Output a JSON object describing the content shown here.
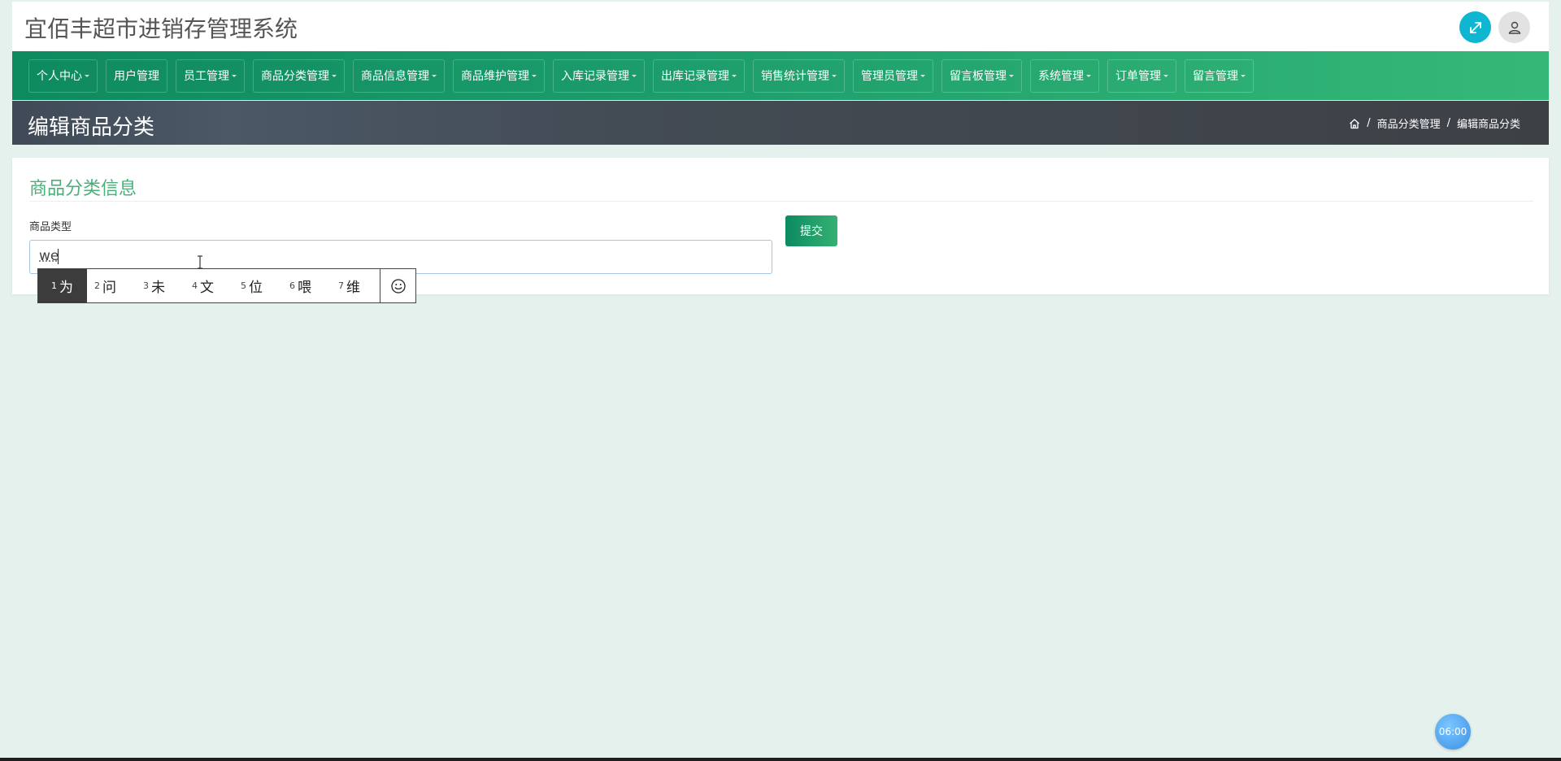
{
  "app": {
    "title": "宜佰丰超市进销存管理系统"
  },
  "header": {
    "expand_icon": "expand-arrows-icon",
    "user_icon": "user-icon",
    "accent_color": "#0fb6d2"
  },
  "nav": {
    "items": [
      {
        "label": "个人中心",
        "dropdown": true
      },
      {
        "label": "用户管理",
        "dropdown": false
      },
      {
        "label": "员工管理",
        "dropdown": true
      },
      {
        "label": "商品分类管理",
        "dropdown": true
      },
      {
        "label": "商品信息管理",
        "dropdown": true
      },
      {
        "label": "商品维护管理",
        "dropdown": true
      },
      {
        "label": "入库记录管理",
        "dropdown": true
      },
      {
        "label": "出库记录管理",
        "dropdown": true
      },
      {
        "label": "销售统计管理",
        "dropdown": true
      },
      {
        "label": "管理员管理",
        "dropdown": true
      },
      {
        "label": "留言板管理",
        "dropdown": true
      },
      {
        "label": "系统管理",
        "dropdown": true
      },
      {
        "label": "订单管理",
        "dropdown": true
      },
      {
        "label": "留言管理",
        "dropdown": true
      }
    ]
  },
  "page_header": {
    "title": "编辑商品分类",
    "breadcrumb": {
      "home_icon": "home-icon",
      "items": [
        "商品分类管理",
        "编辑商品分类"
      ]
    }
  },
  "form": {
    "card_title": "商品分类信息",
    "field_label": "商品类型",
    "input_value": "we",
    "submit_label": "提交"
  },
  "ime": {
    "candidates": [
      {
        "num": "1",
        "text": "为"
      },
      {
        "num": "2",
        "text": "问"
      },
      {
        "num": "3",
        "text": "未"
      },
      {
        "num": "4",
        "text": "文"
      },
      {
        "num": "5",
        "text": "位"
      },
      {
        "num": "6",
        "text": "喂"
      },
      {
        "num": "7",
        "text": "维"
      }
    ],
    "emoji_icon": "smiley-icon"
  },
  "clock": {
    "time": "06:00"
  }
}
